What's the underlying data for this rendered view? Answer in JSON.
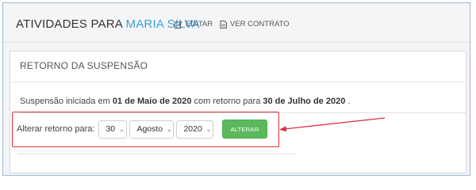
{
  "header": {
    "title_prefix": "ATIVIDADES PARA",
    "client_name": "MARIA SILVA",
    "edit_label": "EDITAR",
    "contract_label": "VER CONTRATO"
  },
  "card": {
    "title": "RETORNO DA SUSPENSÃO",
    "info": {
      "prefix": "Suspensão iniciada em",
      "start_date": "01 de Maio de 2020",
      "middle": "com retorno para",
      "return_date": "30 de Julho de 2020",
      "suffix": "."
    },
    "form": {
      "label": "Alterar retorno para:",
      "day": "30",
      "month": "Agosto",
      "year": "2020",
      "submit_label": "ALTERAR"
    }
  },
  "colors": {
    "accent_name": "#3aa3db",
    "button_green": "#5cb85c",
    "annotation_red": "#e0303c"
  },
  "icons": {
    "edit": "edit-icon",
    "contract": "document-icon",
    "select_chevron": "chevron-down-icon"
  }
}
